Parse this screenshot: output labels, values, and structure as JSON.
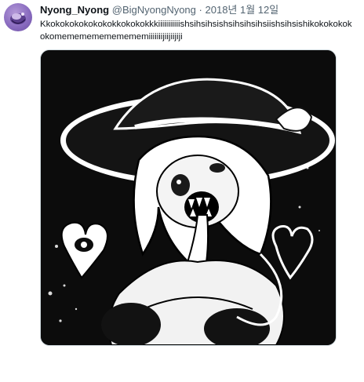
{
  "tweet": {
    "display_name": "Nyong_Nyong",
    "handle": "@BigNyongNyong",
    "separator": "·",
    "date": "2018년 1월 12일",
    "text": "Kkokokokokokokokkokokokkkiiiiiiiiiiishsihsihsishsihsihsihsiishsihsishikokokokokokomemememememememiiiiiiijiijiijiji"
  },
  "avatar": {
    "icon": "avatar-image",
    "accent": "#8a6cc0"
  },
  "media": {
    "icon": "illustration-image",
    "background": "#0c0c0c"
  }
}
